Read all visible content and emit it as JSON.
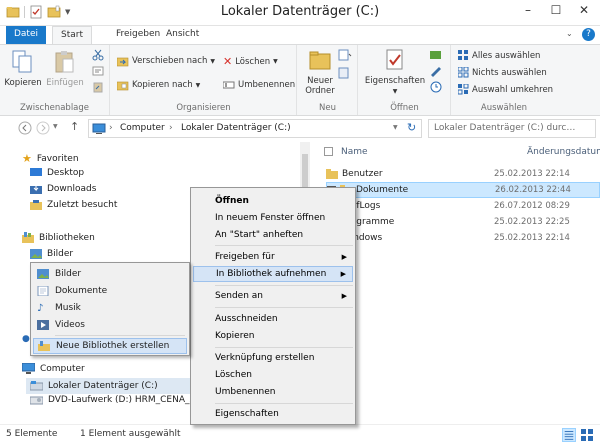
{
  "window": {
    "title": "Lokaler Datenträger (C:)",
    "minimize": "–",
    "maximize": "☐",
    "close": "✕"
  },
  "ribbon_tabs": {
    "file": "Datei",
    "start": "Start",
    "share": "Freigeben",
    "view": "Ansicht",
    "help": "?"
  },
  "ribbon": {
    "clipboard": {
      "label": "Zwischenablage",
      "copy": "Kopieren",
      "paste": "Einfügen"
    },
    "organize": {
      "label": "Organisieren",
      "move_to": "Verschieben nach",
      "copy_to": "Kopieren nach",
      "delete": "Löschen",
      "rename": "Umbenennen"
    },
    "new": {
      "label": "Neu",
      "new_folder_line1": "Neuer",
      "new_folder_line2": "Ordner"
    },
    "open": {
      "label": "Öffnen",
      "properties": "Eigenschaften"
    },
    "select": {
      "label": "Auswählen",
      "select_all": "Alles auswählen",
      "select_none": "Nichts auswählen",
      "invert": "Auswahl umkehren"
    }
  },
  "address": {
    "crumbs": [
      "Computer",
      "Lokaler Datenträger (C:)"
    ],
    "separator": "›",
    "search_placeholder": "Lokaler Datenträger (C:) durc…"
  },
  "nav": {
    "favorites": "Favoriten",
    "desktop": "Desktop",
    "downloads": "Downloads",
    "recent": "Zuletzt besucht",
    "libraries": "Bibliotheken",
    "pictures": "Bilder",
    "computer": "Computer",
    "local_disk": "Lokaler Datenträger (C:)",
    "dvd_drive": "DVD-Laufwerk (D:) HRM_CENA_X8"
  },
  "content": {
    "col_name": "Name",
    "col_date": "Änderungsdatum",
    "files": [
      {
        "name": "Benutzer",
        "date": "25.02.2013 22:14"
      },
      {
        "name": "Dokumente",
        "date": "26.02.2013 22:44"
      },
      {
        "name": "PerfLogs",
        "date": "26.07.2012 08:29"
      },
      {
        "name": "Programme",
        "date": "25.02.2013 22:25"
      },
      {
        "name": "Windows",
        "date": "25.02.2013 22:14"
      }
    ]
  },
  "context_menu": {
    "open": "Öffnen",
    "open_new_window": "In neuem Fenster öffnen",
    "pin_start": "An \"Start\" anheften",
    "share_with": "Freigeben für",
    "include_in_library": "In Bibliothek aufnehmen",
    "send_to": "Senden an",
    "cut": "Ausschneiden",
    "copy": "Kopieren",
    "create_shortcut": "Verknüpfung erstellen",
    "delete": "Löschen",
    "rename": "Umbenennen",
    "properties": "Eigenschaften",
    "arrow": "▶"
  },
  "submenu": {
    "pictures": "Bilder",
    "documents": "Dokumente",
    "music": "Musik",
    "videos": "Videos",
    "new_library": "Neue Bibliothek erstellen"
  },
  "status": {
    "count": "5 Elemente",
    "selected": "1 Element ausgewählt"
  },
  "colors": {
    "accent": "#1979ca",
    "selection": "#cce8ff",
    "hover": "#d5e4f6",
    "folder": "#e8c25a"
  }
}
